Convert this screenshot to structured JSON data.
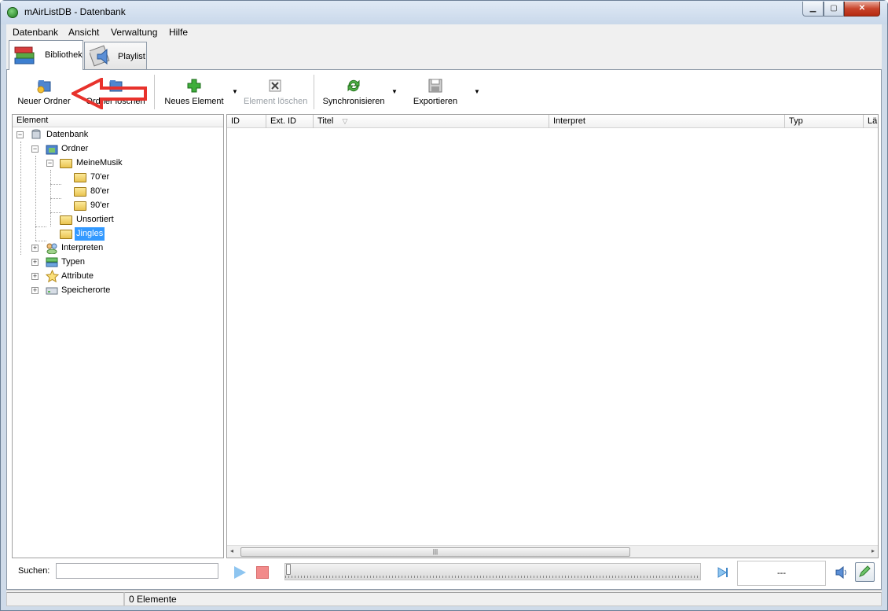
{
  "window": {
    "title": "mAirListDB - Datenbank"
  },
  "menubar": {
    "items": [
      "Datenbank",
      "Ansicht",
      "Verwaltung",
      "Hilfe"
    ]
  },
  "tabs": [
    {
      "label": "Bibliothek",
      "active": true
    },
    {
      "label": "Playlist",
      "active": false
    }
  ],
  "toolbar": {
    "new_folder": "Neuer Ordner",
    "delete_folder": "Ordner löschen",
    "new_element": "Neues Element",
    "delete_element": "Element löschen",
    "sync": "Synchronisieren",
    "export": "Exportieren"
  },
  "tree": {
    "header": "Element",
    "nodes": {
      "root": "Datenbank",
      "ordner": "Ordner",
      "meinemusik": "MeineMusik",
      "f70": "70'er",
      "f80": "80'er",
      "f90": "90'er",
      "unsortiert": "Unsortiert",
      "jingles": "Jingles",
      "interpreten": "Interpreten",
      "typen": "Typen",
      "attribute": "Attribute",
      "speicherorte": "Speicherorte"
    },
    "selected": "Jingles"
  },
  "grid": {
    "columns": [
      "ID",
      "Ext. ID",
      "Titel",
      "Interpret",
      "Typ",
      "Län"
    ],
    "sort_column": "Titel",
    "rows": []
  },
  "search": {
    "label": "Suchen:",
    "value": ""
  },
  "player": {
    "time": "---"
  },
  "status": {
    "count": "0 Elemente"
  },
  "colors": {
    "accent_red_arrow": "#e8322c",
    "selection": "#3399ff"
  }
}
